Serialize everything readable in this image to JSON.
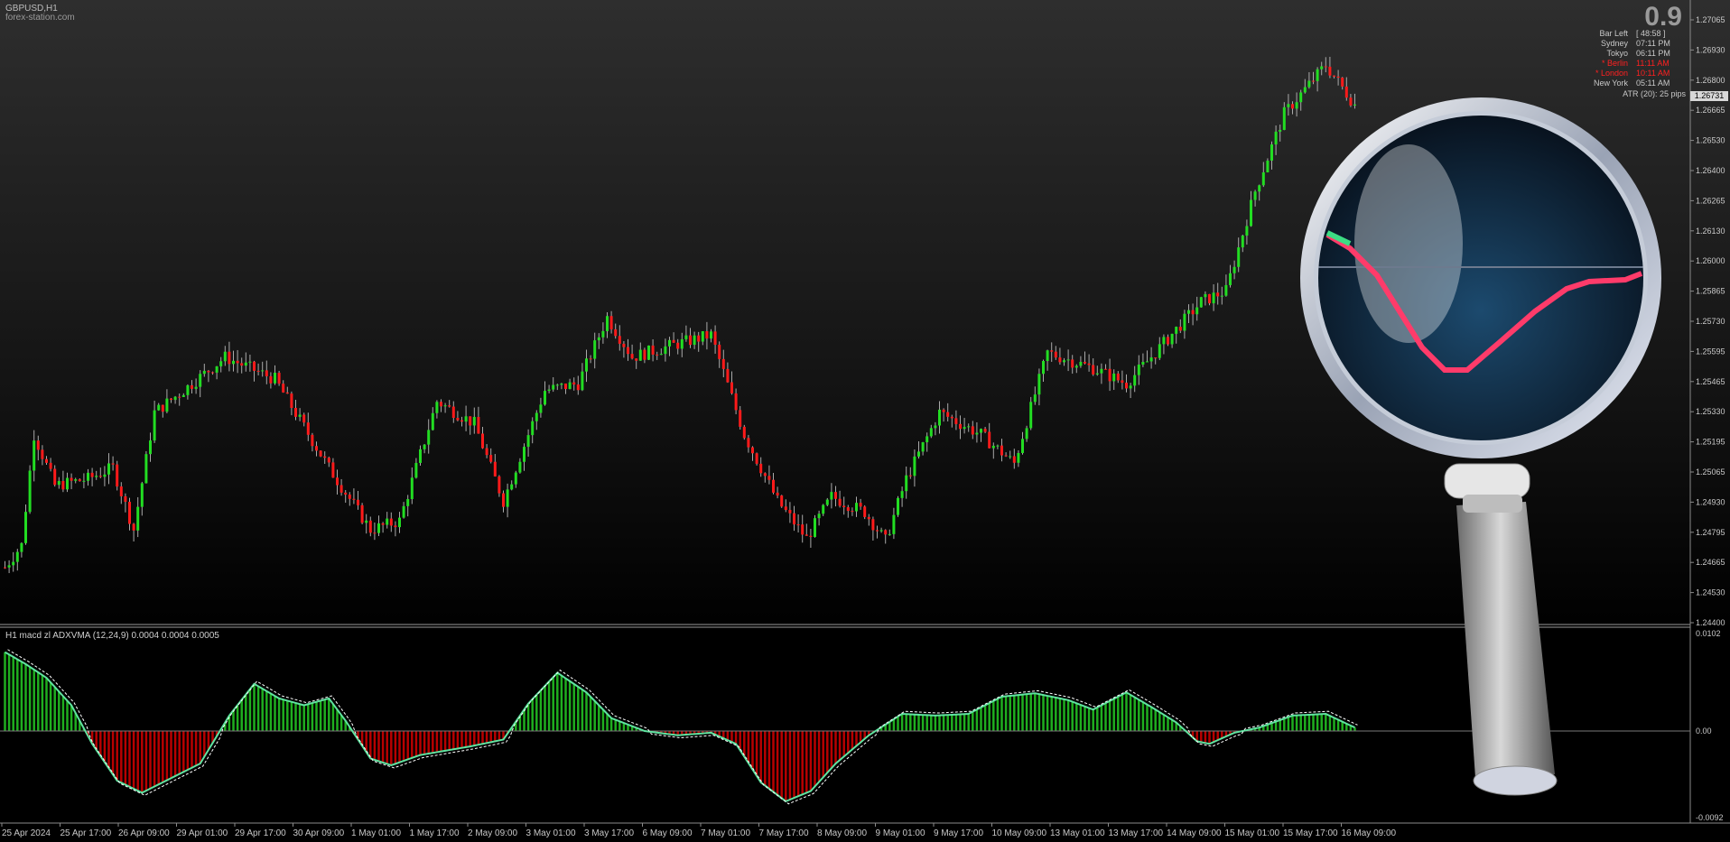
{
  "chart_header": {
    "symbol": "GBPUSD,H1",
    "watermark": "forex-station.com"
  },
  "colors": {
    "bull": "#22dd22",
    "bear": "#ff1a1a",
    "hist_pos": "#1fae1f",
    "hist_neg": "#b80000",
    "signal": "#ffffff",
    "macd_line_pos": "#3ddc84",
    "macd_line_neg": "#ff4d5e"
  },
  "info_panel": {
    "big_value": "0.9",
    "rows": [
      {
        "label": "Bar Left",
        "value": "[ 48:58 ]",
        "color": "#c8c8c8"
      },
      {
        "label": "Sydney",
        "value": "07:11 PM",
        "color": "#c8c8c8"
      },
      {
        "label": "Tokyo",
        "value": "06:11 PM",
        "color": "#c8c8c8"
      },
      {
        "label": "* Berlin",
        "value": "11:11 AM",
        "color": "#ff2020"
      },
      {
        "label": "* London",
        "value": "10:11 AM",
        "color": "#ff2020"
      },
      {
        "label": "New York",
        "value": "05:11 AM",
        "color": "#c8c8c8"
      }
    ],
    "atr": "ATR (20): 25 pips"
  },
  "price_axis": {
    "current_price": "1.26731",
    "ticks": [
      "1.27065",
      "1.26930",
      "1.26800",
      "1.26665",
      "1.26530",
      "1.26400",
      "1.26265",
      "1.26130",
      "1.26000",
      "1.25865",
      "1.25730",
      "1.25595",
      "1.25465",
      "1.25330",
      "1.25195",
      "1.25065",
      "1.24930",
      "1.24795",
      "1.24665",
      "1.24530",
      "1.24400"
    ]
  },
  "indicator": {
    "title": "H1  macd zl ADXVMA (12,24,9)  0.0004 0.0004 0.0005",
    "axis_ticks": [
      "0.0102",
      "0.00",
      "-0.0092"
    ]
  },
  "time_axis": [
    "25 Apr 2024",
    "25 Apr 17:00",
    "26 Apr 09:00",
    "29 Apr 01:00",
    "29 Apr 17:00",
    "30 Apr 09:00",
    "1 May 01:00",
    "1 May 17:00",
    "2 May 09:00",
    "3 May 01:00",
    "3 May 17:00",
    "6 May 09:00",
    "7 May 01:00",
    "7 May 17:00",
    "8 May 09:00",
    "9 May 01:00",
    "9 May 17:00",
    "10 May 09:00",
    "13 May 01:00",
    "13 May 17:00",
    "14 May 09:00",
    "15 May 01:00",
    "15 May 17:00",
    "16 May 09:00"
  ],
  "chart_data": {
    "type": "candlestick",
    "price_range": [
      1.244,
      1.2714
    ],
    "close_path": [
      [
        0,
        1.2465
      ],
      [
        4,
        1.2475
      ],
      [
        7,
        1.2525
      ],
      [
        12,
        1.2502
      ],
      [
        20,
        1.2505
      ],
      [
        26,
        1.251
      ],
      [
        31,
        1.2482
      ],
      [
        36,
        1.2535
      ],
      [
        43,
        1.2545
      ],
      [
        53,
        1.256
      ],
      [
        65,
        1.255
      ],
      [
        78,
        1.251
      ],
      [
        88,
        1.2482
      ],
      [
        95,
        1.2486
      ],
      [
        104,
        1.254
      ],
      [
        113,
        1.253
      ],
      [
        120,
        1.2495
      ],
      [
        130,
        1.2545
      ],
      [
        138,
        1.2548
      ],
      [
        145,
        1.2578
      ],
      [
        151,
        1.256
      ],
      [
        160,
        1.2565
      ],
      [
        170,
        1.257
      ],
      [
        178,
        1.2525
      ],
      [
        186,
        1.2495
      ],
      [
        193,
        1.2478
      ],
      [
        199,
        1.2497
      ],
      [
        207,
        1.249
      ],
      [
        212,
        1.2477
      ],
      [
        217,
        1.2505
      ],
      [
        225,
        1.2535
      ],
      [
        235,
        1.2525
      ],
      [
        243,
        1.2512
      ],
      [
        251,
        1.2562
      ],
      [
        262,
        1.2555
      ],
      [
        270,
        1.2548
      ],
      [
        275,
        1.2558
      ],
      [
        288,
        1.2585
      ],
      [
        294,
        1.259
      ],
      [
        301,
        1.2635
      ],
      [
        308,
        1.267
      ],
      [
        318,
        1.2692
      ],
      [
        325,
        1.2674
      ]
    ],
    "macd_path": [
      [
        0,
        0.0092
      ],
      [
        5,
        0.0078
      ],
      [
        10,
        0.0062
      ],
      [
        16,
        0.003
      ],
      [
        21,
        -0.0015
      ],
      [
        27,
        -0.0058
      ],
      [
        33,
        -0.0072
      ],
      [
        40,
        -0.0055
      ],
      [
        47,
        -0.0038
      ],
      [
        54,
        0.0018
      ],
      [
        60,
        0.0055
      ],
      [
        66,
        0.0038
      ],
      [
        72,
        0.003
      ],
      [
        78,
        0.0038
      ],
      [
        82,
        0.0012
      ],
      [
        88,
        -0.0032
      ],
      [
        93,
        -0.004
      ],
      [
        100,
        -0.0028
      ],
      [
        112,
        -0.0018
      ],
      [
        120,
        -0.001
      ],
      [
        126,
        0.0032
      ],
      [
        133,
        0.0068
      ],
      [
        140,
        0.0045
      ],
      [
        146,
        0.0015
      ],
      [
        154,
        0.0
      ],
      [
        162,
        -0.0005
      ],
      [
        170,
        -0.0002
      ],
      [
        176,
        -0.0015
      ],
      [
        182,
        -0.006
      ],
      [
        188,
        -0.0082
      ],
      [
        194,
        -0.007
      ],
      [
        200,
        -0.0038
      ],
      [
        208,
        -0.0005
      ],
      [
        216,
        0.002
      ],
      [
        224,
        0.0018
      ],
      [
        232,
        0.002
      ],
      [
        240,
        0.004
      ],
      [
        248,
        0.0044
      ],
      [
        256,
        0.0036
      ],
      [
        262,
        0.0025
      ],
      [
        270,
        0.0045
      ],
      [
        276,
        0.0028
      ],
      [
        282,
        0.001
      ],
      [
        287,
        -0.0012
      ],
      [
        290,
        -0.0015
      ],
      [
        296,
        -0.0002
      ],
      [
        302,
        0.0004
      ],
      [
        310,
        0.0018
      ],
      [
        318,
        0.002
      ],
      [
        325,
        0.0004
      ]
    ],
    "signal_offset": 0.0003
  },
  "magnifier": {
    "icon": "magnifying-glass-icon"
  }
}
